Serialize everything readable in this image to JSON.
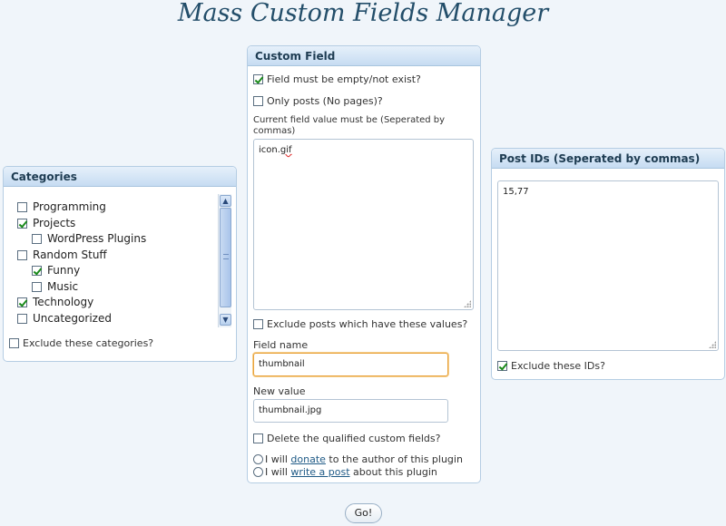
{
  "page": {
    "title": "Mass Custom Fields Manager"
  },
  "categories": {
    "header": "Categories",
    "items": [
      {
        "label": "Programming",
        "checked": false,
        "indent": 0
      },
      {
        "label": "Projects",
        "checked": true,
        "indent": 0
      },
      {
        "label": "WordPress Plugins",
        "checked": false,
        "indent": 1
      },
      {
        "label": "Random Stuff",
        "checked": false,
        "indent": 0
      },
      {
        "label": "Funny",
        "checked": true,
        "indent": 1
      },
      {
        "label": "Music",
        "checked": false,
        "indent": 1
      },
      {
        "label": "Technology",
        "checked": true,
        "indent": 0
      },
      {
        "label": "Uncategorized",
        "checked": false,
        "indent": 0
      }
    ],
    "exclude_label": "Exclude these categories?",
    "exclude_checked": false
  },
  "custom_field": {
    "header": "Custom Field",
    "must_be_empty_label": "Field must be empty/not exist?",
    "must_be_empty_checked": true,
    "only_posts_label": "Only posts (No pages)?",
    "only_posts_checked": false,
    "current_value_label": "Current field value must be (Seperated by commas)",
    "current_value_text_a": "icon.",
    "current_value_text_b": "gif",
    "exclude_values_label": "Exclude posts which have these values?",
    "exclude_values_checked": false,
    "field_name_label": "Field name",
    "field_name_value": "thumbnail",
    "new_value_label": "New value",
    "new_value_value": "thumbnail.jpg",
    "delete_label": "Delete the qualified custom fields?",
    "delete_checked": false,
    "donate": {
      "pre": "I will ",
      "link": "donate",
      "post": " to the author of this plugin"
    },
    "write_post": {
      "pre": "I will ",
      "link": "write a post",
      "post": " about this plugin"
    }
  },
  "post_ids": {
    "header": "Post IDs (Seperated by commas)",
    "value": "15,77",
    "exclude_label": "Exclude these IDs?",
    "exclude_checked": true
  },
  "go_label": "Go!"
}
